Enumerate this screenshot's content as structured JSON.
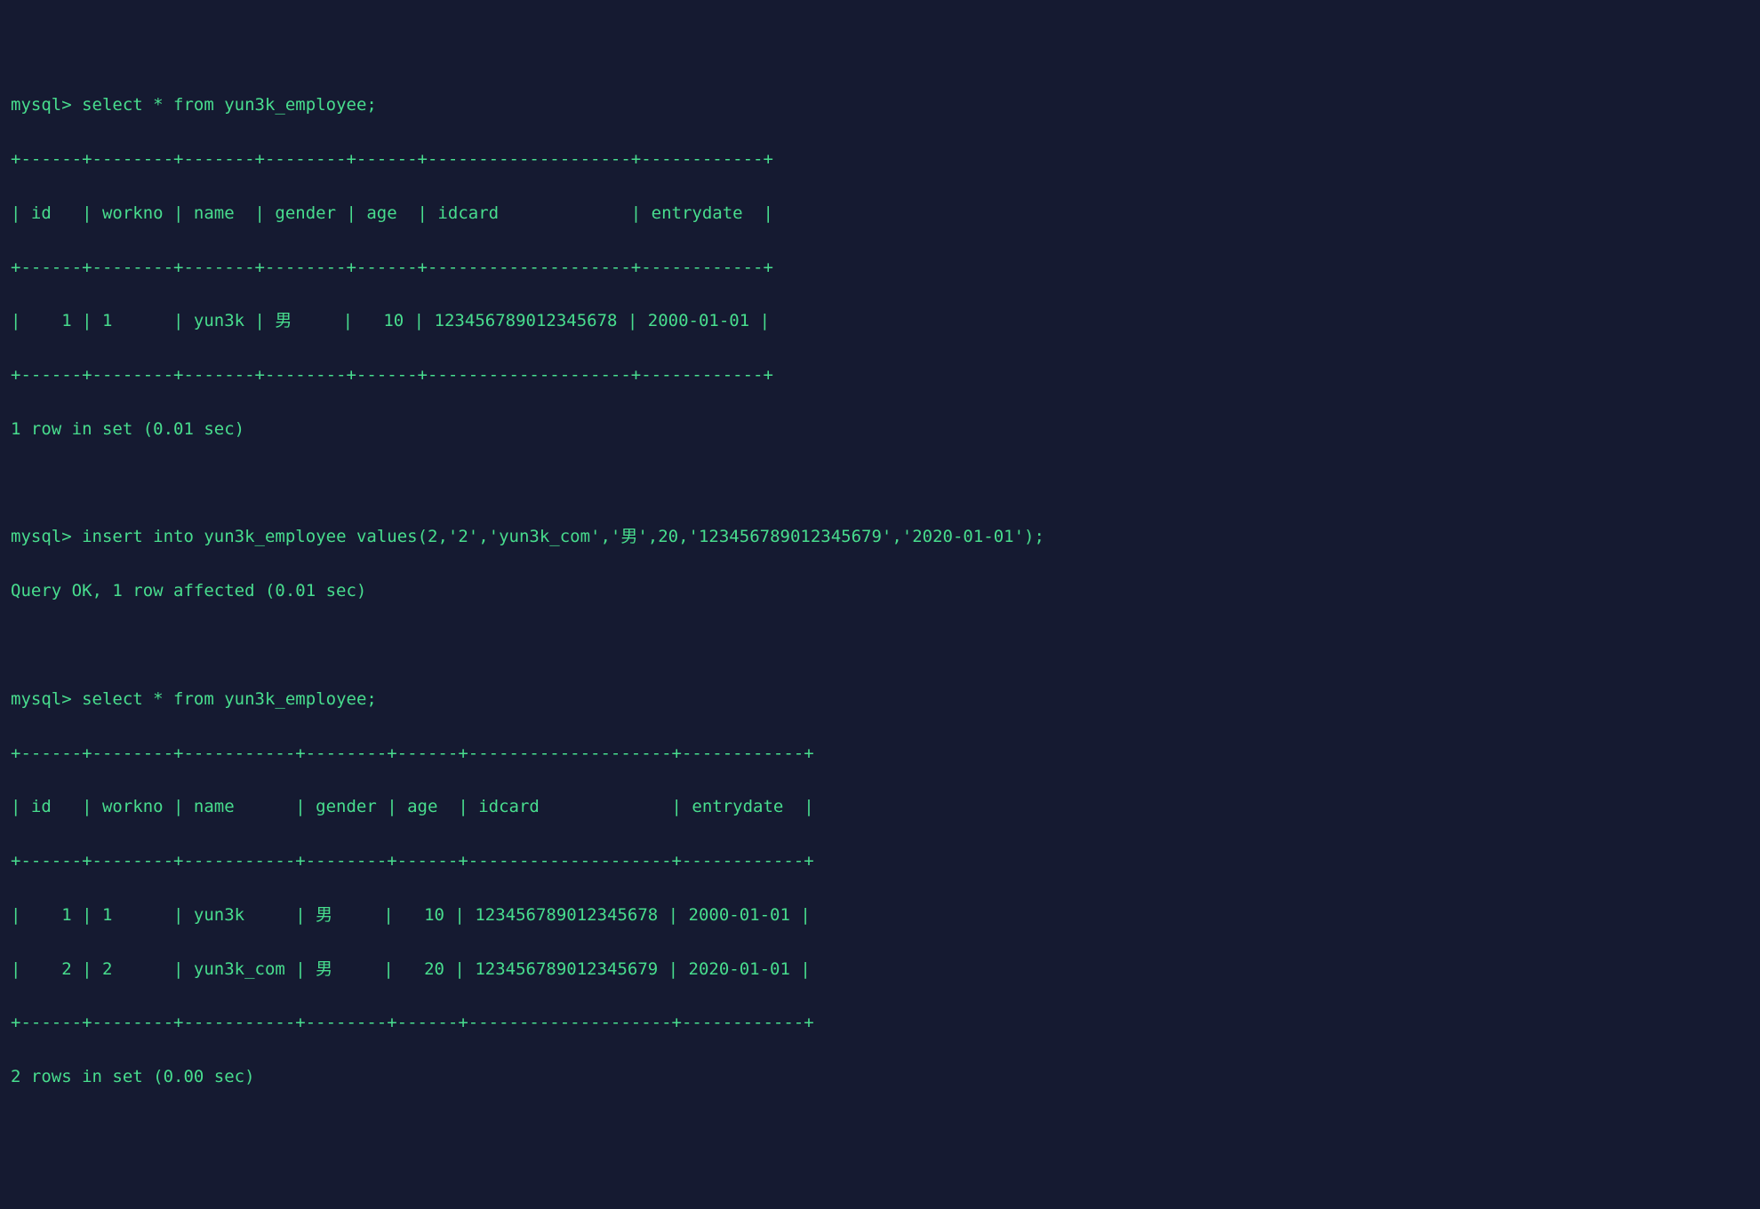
{
  "prompt": "mysql>",
  "queries": {
    "select1": "select * from yun3k_employee;",
    "insert": "insert into yun3k_employee values(2,'2','yun3k_com','男',20,'123456789012345679','2020-01-01');",
    "select2": "select * from yun3k_employee;"
  },
  "table1": {
    "sep": "+------+--------+-------+--------+------+--------------------+------------+",
    "header": "| id   | workno | name  | gender | age  | idcard             | entrydate  |",
    "rows": [
      "|    1 | 1      | yun3k | 男     |   10 | 123456789012345678 | 2000-01-01 |"
    ],
    "footer": "1 row in set (0.01 sec)"
  },
  "insert_result": "Query OK, 1 row affected (0.01 sec)",
  "table2": {
    "sep": "+------+--------+-----------+--------+------+--------------------+------------+",
    "header": "| id   | workno | name      | gender | age  | idcard             | entrydate  |",
    "rows": [
      "|    1 | 1      | yun3k     | 男     |   10 | 123456789012345678 | 2000-01-01 |",
      "|    2 | 2      | yun3k_com | 男     |   20 | 123456789012345679 | 2020-01-01 |"
    ],
    "footer": "2 rows in set (0.00 sec)"
  },
  "chart_data": {
    "type": "table",
    "title": "yun3k_employee",
    "columns": [
      "id",
      "workno",
      "name",
      "gender",
      "age",
      "idcard",
      "entrydate"
    ],
    "initial_rows": [
      {
        "id": 1,
        "workno": "1",
        "name": "yun3k",
        "gender": "男",
        "age": 10,
        "idcard": "123456789012345678",
        "entrydate": "2000-01-01"
      }
    ],
    "inserted_row": {
      "id": 2,
      "workno": "2",
      "name": "yun3k_com",
      "gender": "男",
      "age": 20,
      "idcard": "123456789012345679",
      "entrydate": "2020-01-01"
    },
    "final_rows": [
      {
        "id": 1,
        "workno": "1",
        "name": "yun3k",
        "gender": "男",
        "age": 10,
        "idcard": "123456789012345678",
        "entrydate": "2000-01-01"
      },
      {
        "id": 2,
        "workno": "2",
        "name": "yun3k_com",
        "gender": "男",
        "age": 20,
        "idcard": "123456789012345679",
        "entrydate": "2020-01-01"
      }
    ]
  }
}
